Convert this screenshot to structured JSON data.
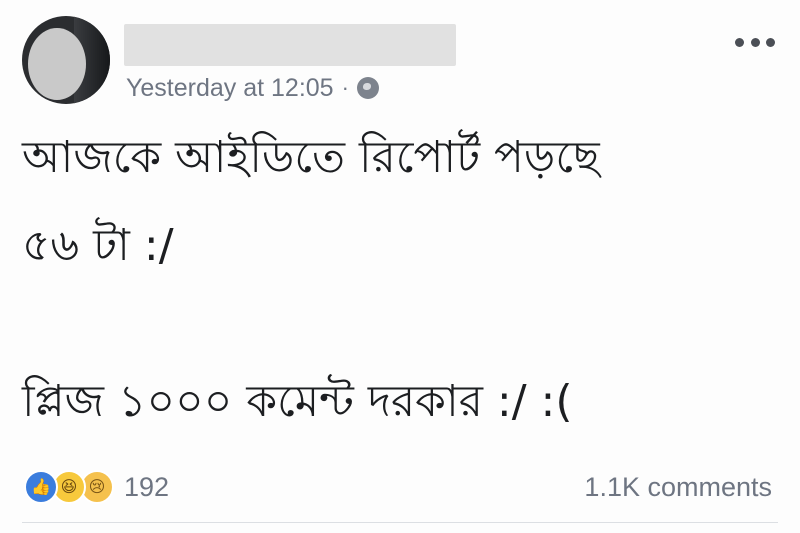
{
  "post": {
    "timestamp": "Yesterday at 12:05",
    "separator": "·",
    "privacy_icon": "globe-icon",
    "more_icon": "more-options-icon",
    "lines": [
      "আজকে আইডিতে রিপোর্ট পড়ছে",
      "৫৬ টা :/",
      "প্লিজ ১০০০ কমেন্ট দরকার :/ :("
    ]
  },
  "footer": {
    "reactions": [
      {
        "name": "like",
        "glyph": "👍",
        "icon": "like-reaction-icon",
        "color": "#3b7ddd"
      },
      {
        "name": "haha",
        "glyph": "😆",
        "icon": "haha-reaction-icon",
        "color": "#f7c93c"
      },
      {
        "name": "sad",
        "glyph": "😢",
        "icon": "sad-reaction-icon",
        "color": "#f5c14d"
      }
    ],
    "reaction_count": "192",
    "comments": "1.1K comments"
  }
}
